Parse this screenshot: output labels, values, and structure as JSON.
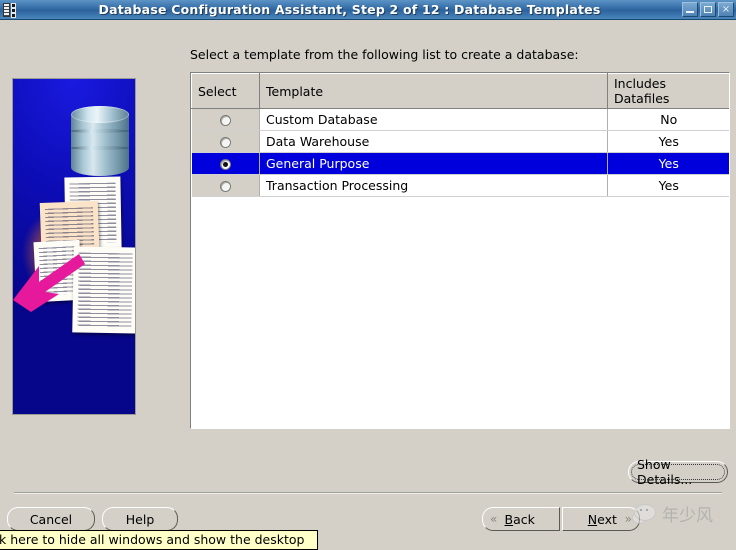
{
  "window": {
    "title": "Database Configuration Assistant, Step 2 of 12 : Database Templates",
    "icon": "app-filmstrip-icon",
    "controls": {
      "minimize": "minimize-icon",
      "maximize": "maximize-icon",
      "close": "×"
    }
  },
  "main": {
    "instruction": "Select a template from the following list to create a database:",
    "table": {
      "columns": [
        "Select",
        "Template",
        "Includes Datafiles"
      ],
      "rows": [
        {
          "selected": false,
          "template": "Custom Database",
          "includes_datafiles": "No"
        },
        {
          "selected": false,
          "template": "Data Warehouse",
          "includes_datafiles": "Yes"
        },
        {
          "selected": true,
          "template": "General Purpose",
          "includes_datafiles": "Yes"
        },
        {
          "selected": false,
          "template": "Transaction Processing",
          "includes_datafiles": "Yes"
        }
      ]
    },
    "show_details_label": "Show Details..."
  },
  "footer": {
    "cancel_label": "Cancel",
    "help_label": "Help",
    "back_label": "Back",
    "next_label": "Next",
    "back_chevron": "«",
    "next_chevron": "»"
  },
  "watermark": {
    "text": "年少风",
    "icon": "wechat-bubble-icon"
  },
  "tooltip": {
    "text": "k here to hide all windows and show the desktop"
  },
  "colors": {
    "titlebar": "#336ca6",
    "dialog_face": "#d4d0c8",
    "selection": "#0000dd",
    "illustration_bg": "#0000cc",
    "arrow": "#e6189c",
    "tooltip_bg": "#ffffc8"
  }
}
